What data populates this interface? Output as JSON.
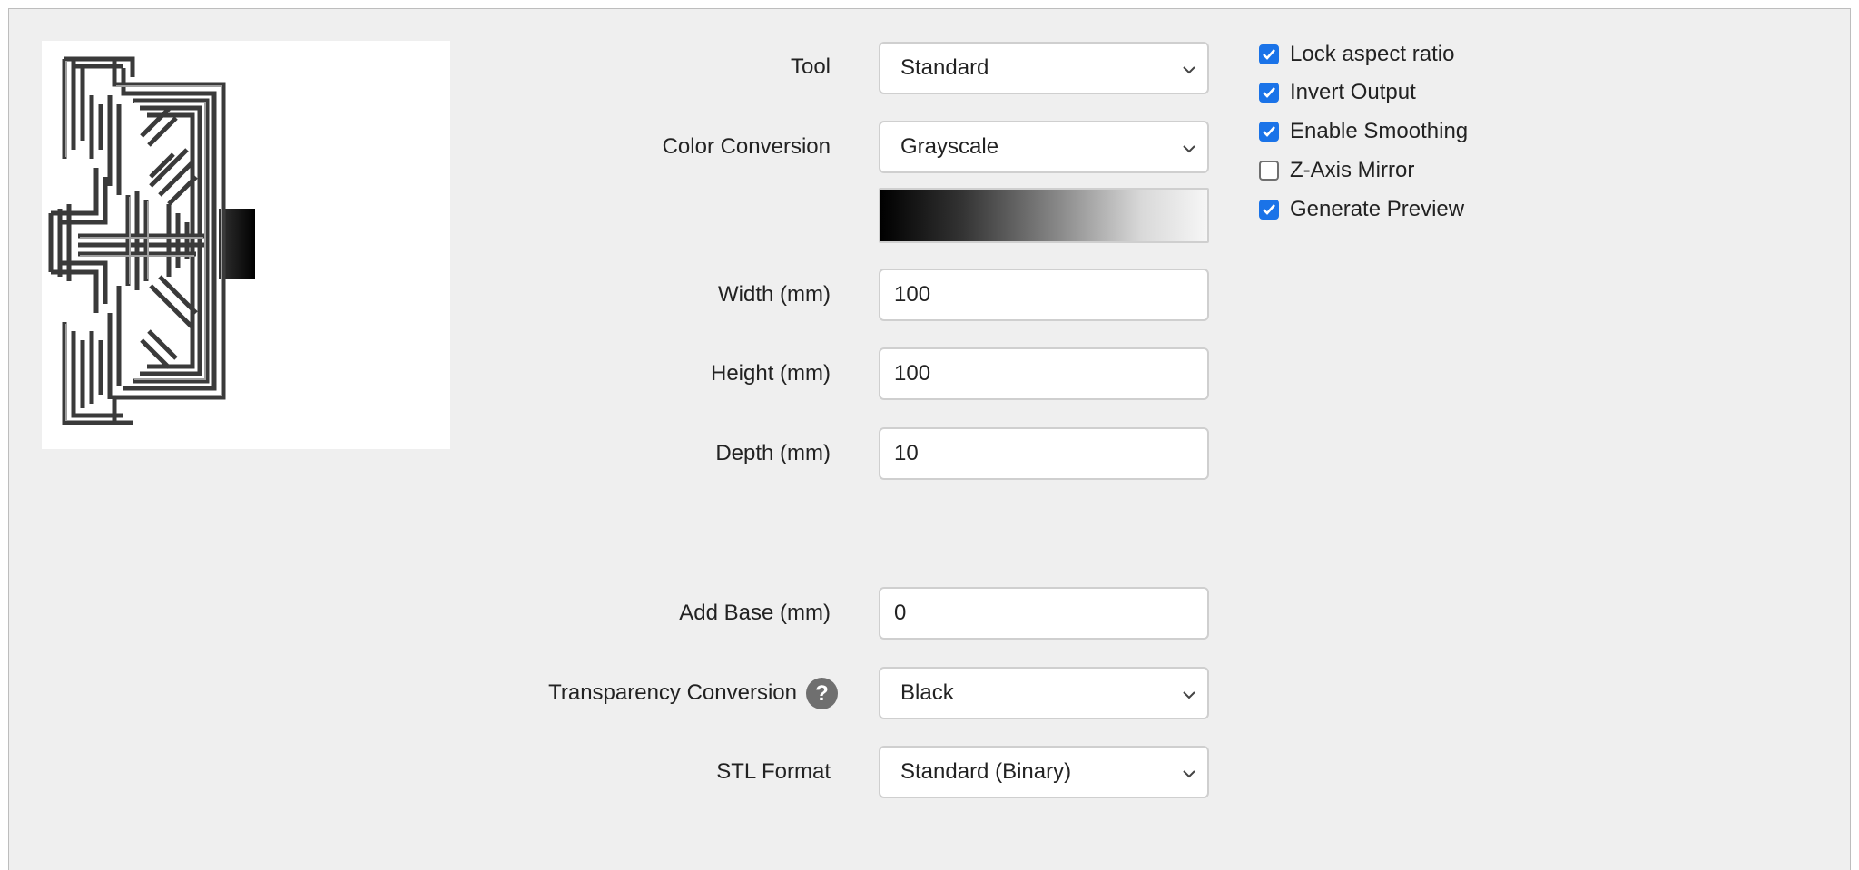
{
  "form": {
    "tool": {
      "label": "Tool",
      "value": "Standard"
    },
    "color_conversion": {
      "label": "Color Conversion",
      "value": "Grayscale"
    },
    "width": {
      "label": "Width (mm)",
      "value": "100"
    },
    "height": {
      "label": "Height (mm)",
      "value": "100"
    },
    "depth": {
      "label": "Depth (mm)",
      "value": "10"
    },
    "add_base": {
      "label": "Add Base (mm)",
      "value": "0"
    },
    "transparency_conversion": {
      "label": "Transparency Conversion",
      "value": "Black",
      "help_icon": "?"
    },
    "stl_format": {
      "label": "STL Format",
      "value": "Standard (Binary)"
    }
  },
  "options": [
    {
      "label": "Lock aspect ratio",
      "checked": true
    },
    {
      "label": "Invert Output",
      "checked": true
    },
    {
      "label": "Enable Smoothing",
      "checked": true
    },
    {
      "label": "Z-Axis Mirror",
      "checked": false
    },
    {
      "label": "Generate Preview",
      "checked": true
    }
  ],
  "icons": {
    "select_arrow": "chevron-down-icon",
    "checkbox_mark": "check-icon",
    "help": "question-circle-icon"
  },
  "colors": {
    "accent": "#1a73e8",
    "panel_background": "#efefef"
  }
}
